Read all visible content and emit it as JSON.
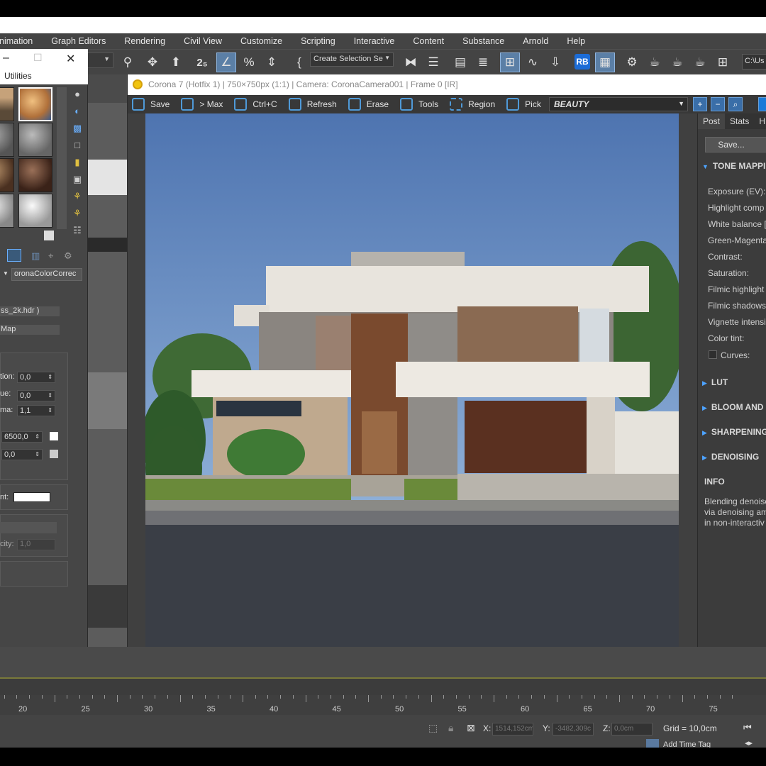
{
  "menubar": {
    "items": [
      "nimation",
      "Graph Editors",
      "Rendering",
      "Civil View",
      "Customize",
      "Scripting",
      "Interactive",
      "Content",
      "Substance",
      "Arnold",
      "Help"
    ]
  },
  "toolbar": {
    "selection_set_placeholder": "Create Selection Se",
    "path_text": "C:\\Us",
    "rb_label": "RB"
  },
  "material_editor": {
    "minimize_glyph": "–",
    "maximize_glyph": "☐",
    "close_glyph": "✕",
    "menu_label": "Utilities",
    "map_name": "oronaColorCorrec",
    "hdr_file": "ss_2k.hdr )",
    "map_type": "Map",
    "params": [
      {
        "label": "tion:",
        "value": "0,0"
      },
      {
        "label": "ue:",
        "value": "0,0"
      },
      {
        "label": "ma:",
        "value": "1,1"
      },
      {
        "label": "",
        "value": "6500,0"
      },
      {
        "label": "",
        "value": "0,0"
      }
    ],
    "tint_label": "nt:",
    "opacity_label": "city:",
    "opacity_value": "1,0"
  },
  "vfb": {
    "title": "Corona 7 (Hotfix 1) | 750×750px (1:1) | Camera: CoronaCamera001 | Frame 0 [IR]",
    "buttons": {
      "save": "Save",
      "max": "> Max",
      "copy": "Ctrl+C",
      "refresh": "Refresh",
      "erase": "Erase",
      "tools": "Tools",
      "region": "Region",
      "pick": "Pick"
    },
    "channel": "BEAUTY"
  },
  "post_panel": {
    "tabs": [
      "Post",
      "Stats",
      "H"
    ],
    "save_button": "Save...",
    "tone_mapping": "TONE MAPPIN",
    "params": [
      "Exposure (EV):",
      "Highlight comp",
      "White balance [",
      "Green-Magenta",
      "Contrast:",
      "Saturation:",
      "Filmic highlight",
      "Filmic shadows:",
      "Vignette intensi",
      "Color tint:"
    ],
    "curves": "Curves:",
    "sections": [
      "LUT",
      "BLOOM AND G",
      "SHARPENING/",
      "DENOISING"
    ],
    "info_header": "INFO",
    "info_lines": [
      "Blending denoise",
      "via denoising am",
      "in non-interactiv"
    ]
  },
  "timeline": {
    "ticks": [
      "20",
      "25",
      "30",
      "35",
      "40",
      "45",
      "50",
      "55",
      "60",
      "65",
      "70",
      "75"
    ]
  },
  "status": {
    "x_label": "X:",
    "x_value": "1514,152cm",
    "y_label": "Y:",
    "y_value": "-3482,309c",
    "z_label": "Z:",
    "z_value": "0,0cm",
    "grid": "Grid = 10,0cm",
    "time_tag": "Add Time Tag"
  },
  "colors": {
    "accent": "#4f9ad8",
    "sky": "#5a7fb7",
    "panel": "#444444"
  }
}
